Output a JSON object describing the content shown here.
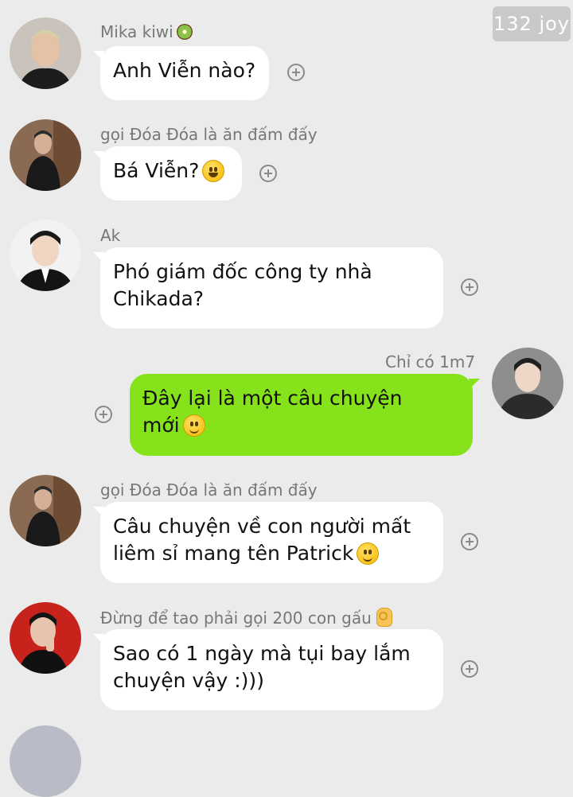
{
  "watermark": "132 joy",
  "messages": [
    {
      "sender": "Mika kiwi",
      "line1": "Anh Viễn nào?",
      "line2": ""
    },
    {
      "sender": "gọi Đóa Đóa là ăn đấm đấy",
      "line1": "Bá Viễn?",
      "line2": ""
    },
    {
      "sender": "Ak",
      "line1": "Phó giám đốc công ty nhà",
      "line2": "Chikada?"
    },
    {
      "sender": "Chỉ có 1m7",
      "line1": "Đây lại là một câu chuyện",
      "line2": "mới"
    },
    {
      "sender": "gọi Đóa Đóa là ăn đấm đấy",
      "line1": "Câu chuyện về con người mất",
      "line2": "liêm sỉ mang tên Patrick"
    },
    {
      "sender": "Đừng để tao phải gọi 200 con gấu",
      "line1": "Sao có 1 ngày mà tụi bay lắm",
      "line2": "chuyện vậy :)))"
    }
  ],
  "icons": {
    "add": "plus-circle-icon",
    "kiwi": "kiwi-emoji",
    "grin": "grinning-face-emoji",
    "smile": "slightly-smiling-face-emoji",
    "ok": "ok-hand-emoji"
  },
  "colors": {
    "background": "#ebebeb",
    "incoming_bubble": "#ffffff",
    "outgoing_bubble": "#86e21b",
    "sender_text": "#777777"
  }
}
